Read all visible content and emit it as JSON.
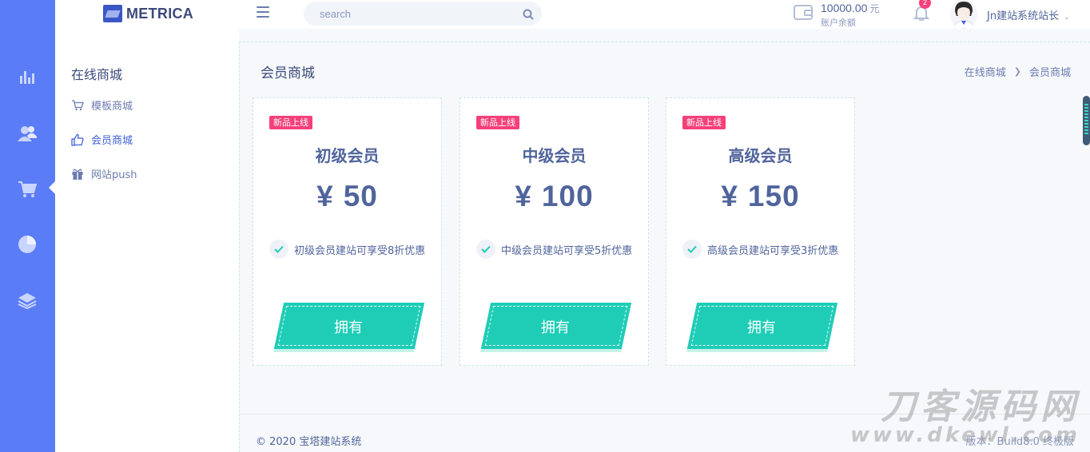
{
  "header": {
    "logo_text": "METRICA",
    "search_placeholder": "search",
    "balance_amount": "10000.00",
    "balance_unit": "元",
    "balance_label": "账户余额",
    "notification_count": "2",
    "user_name": "Jn建站系统站长"
  },
  "rail": {
    "icons": [
      "bar-chart-icon",
      "users-icon",
      "shopping-cart-icon",
      "pie-chart-icon",
      "layers-icon"
    ],
    "color": "#5b7cf7"
  },
  "sidebar": {
    "title": "在线商城",
    "items": [
      {
        "label": "模板商城",
        "icon": "cart-icon",
        "active": false
      },
      {
        "label": "会员商城",
        "icon": "thumbs-up-icon",
        "active": true
      },
      {
        "label": "网站push",
        "icon": "gift-icon",
        "active": false
      }
    ]
  },
  "page": {
    "title": "会员商城",
    "breadcrumb": [
      "在线商城",
      "会员商城"
    ]
  },
  "cards": [
    {
      "tag": "新品上线",
      "name": "初级会员",
      "currency": "¥",
      "price": "50",
      "feature": "初级会员建站可享受8折优惠",
      "button": "拥有"
    },
    {
      "tag": "新品上线",
      "name": "中级会员",
      "currency": "¥",
      "price": "100",
      "feature": "中级会员建站可享受5折优惠",
      "button": "拥有"
    },
    {
      "tag": "新品上线",
      "name": "高级会员",
      "currency": "¥",
      "price": "150",
      "feature": "高级会员建站可享受3折优惠",
      "button": "拥有"
    }
  ],
  "footer": {
    "copyright": "© 2020 宝塔建站系统",
    "version": "版本：Build8.0 终极版"
  },
  "watermark": {
    "line1": "刀客源码网",
    "line2": "www.dkewl.com"
  },
  "colors": {
    "accent": "#1fcdb6",
    "tag": "#f5407a",
    "primary_text": "#50649c",
    "active_link": "#3f61d8"
  }
}
